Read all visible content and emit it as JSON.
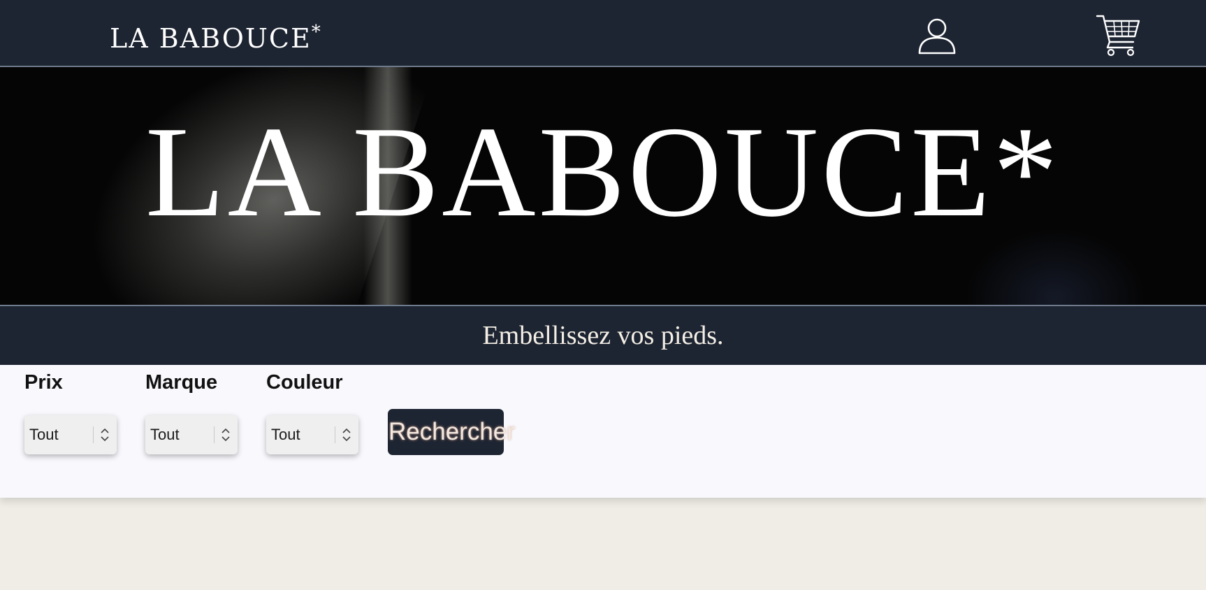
{
  "header": {
    "brand": "LA BABOUCE",
    "brand_mark": "*",
    "account_icon": "user-icon",
    "cart_icon": "cart-icon"
  },
  "hero": {
    "title": "LA BABOUCE*"
  },
  "tagline": "Embellissez vos pieds.",
  "filters": {
    "price": {
      "label": "Prix",
      "value": "Tout"
    },
    "brand": {
      "label": "Marque",
      "value": "Tout"
    },
    "color": {
      "label": "Couleur",
      "value": "Tout"
    },
    "search_label": "Rechercher"
  },
  "colors": {
    "navy": "#1e2532",
    "page_bg": "#f0ede6",
    "panel_bg": "#f8f8fd"
  }
}
